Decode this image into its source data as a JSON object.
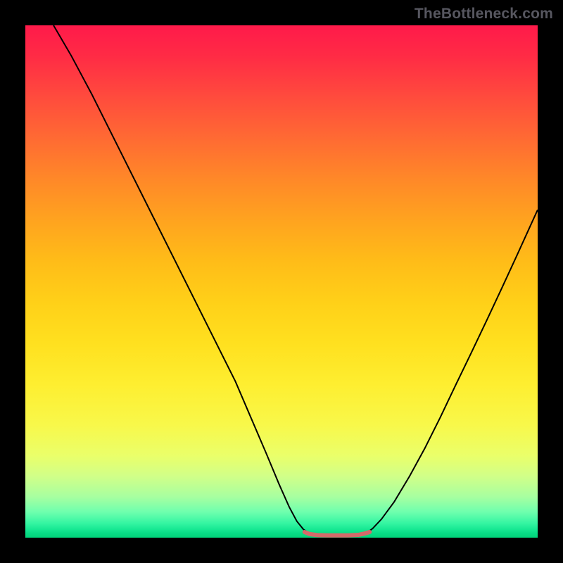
{
  "watermark": "TheBottleneck.com",
  "chart_data": {
    "type": "line",
    "title": "",
    "xlabel": "",
    "ylabel": "",
    "xlim": [
      0,
      100
    ],
    "ylim": [
      0,
      100
    ],
    "grid": false,
    "legend": false,
    "series": [
      {
        "name": "curve-left",
        "stroke": "#000000",
        "width": 2,
        "points": [
          {
            "x": 5.5,
            "y": 100
          },
          {
            "x": 9,
            "y": 94
          },
          {
            "x": 13,
            "y": 86.5
          },
          {
            "x": 17,
            "y": 78.5
          },
          {
            "x": 21,
            "y": 70.5
          },
          {
            "x": 25,
            "y": 62.5
          },
          {
            "x": 29,
            "y": 54.5
          },
          {
            "x": 33,
            "y": 46.5
          },
          {
            "x": 37,
            "y": 38.5
          },
          {
            "x": 41,
            "y": 30.5
          },
          {
            "x": 44,
            "y": 23.5
          },
          {
            "x": 47,
            "y": 16.5
          },
          {
            "x": 49.5,
            "y": 10.5
          },
          {
            "x": 51.5,
            "y": 6
          },
          {
            "x": 53,
            "y": 3.2
          },
          {
            "x": 54.3,
            "y": 1.6
          },
          {
            "x": 55.5,
            "y": 0.8
          }
        ]
      },
      {
        "name": "curve-right",
        "stroke": "#000000",
        "width": 2,
        "points": [
          {
            "x": 66.5,
            "y": 0.8
          },
          {
            "x": 67.8,
            "y": 1.8
          },
          {
            "x": 69.5,
            "y": 3.6
          },
          {
            "x": 72,
            "y": 7
          },
          {
            "x": 75,
            "y": 12
          },
          {
            "x": 78,
            "y": 17.5
          },
          {
            "x": 81,
            "y": 23.5
          },
          {
            "x": 84,
            "y": 29.8
          },
          {
            "x": 87,
            "y": 36
          },
          {
            "x": 90,
            "y": 42.3
          },
          {
            "x": 93,
            "y": 48.7
          },
          {
            "x": 96,
            "y": 55.2
          },
          {
            "x": 99,
            "y": 61.8
          },
          {
            "x": 100,
            "y": 64
          }
        ]
      },
      {
        "name": "flat-bottom",
        "stroke": "#d46a6a",
        "width": 6,
        "points": [
          {
            "x": 54.5,
            "y": 1.1
          },
          {
            "x": 55.5,
            "y": 0.7
          },
          {
            "x": 57,
            "y": 0.5
          },
          {
            "x": 59,
            "y": 0.45
          },
          {
            "x": 61,
            "y": 0.45
          },
          {
            "x": 63,
            "y": 0.45
          },
          {
            "x": 65,
            "y": 0.55
          },
          {
            "x": 66.2,
            "y": 0.8
          },
          {
            "x": 67.2,
            "y": 1.1
          }
        ]
      }
    ]
  }
}
